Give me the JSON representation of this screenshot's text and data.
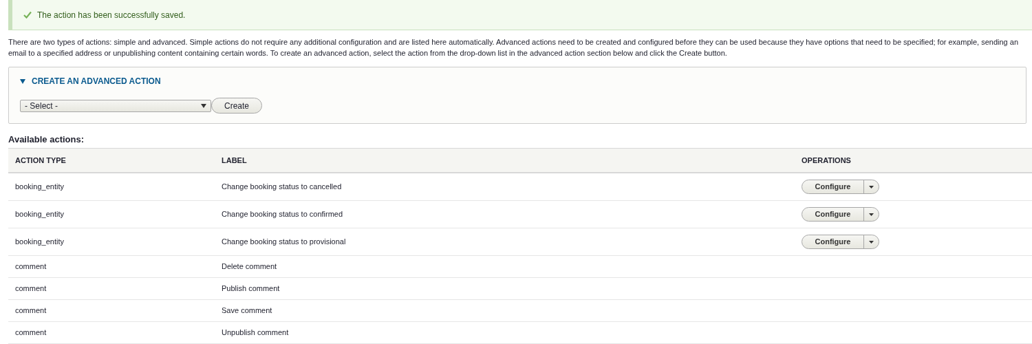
{
  "message": {
    "kind": "status",
    "text": "The action has been successfully saved."
  },
  "description": "There are two types of actions: simple and advanced. Simple actions do not require any additional configuration and are listed here automatically. Advanced actions need to be created and configured before they can be used because they have options that need to be specified; for example, sending an email to a specified address or unpublishing content containing certain words. To create an advanced action, select the action from the drop-down list in the advanced action section below and click the Create button.",
  "advanced_action": {
    "title": "CREATE AN ADVANCED ACTION",
    "expanded": true,
    "select": {
      "value": "- Select -"
    },
    "button": "Create"
  },
  "table": {
    "caption": "Available actions:",
    "columns": [
      "ACTION TYPE",
      "LABEL",
      "OPERATIONS"
    ],
    "rows": [
      {
        "type": "booking_entity",
        "label": "Change booking status to cancelled",
        "operation": "Configure"
      },
      {
        "type": "booking_entity",
        "label": "Change booking status to confirmed",
        "operation": "Configure"
      },
      {
        "type": "booking_entity",
        "label": "Change booking status to provisional",
        "operation": "Configure"
      },
      {
        "type": "comment",
        "label": "Delete comment"
      },
      {
        "type": "comment",
        "label": "Publish comment"
      },
      {
        "type": "comment",
        "label": "Save comment"
      },
      {
        "type": "comment",
        "label": "Unpublish comment"
      }
    ]
  }
}
